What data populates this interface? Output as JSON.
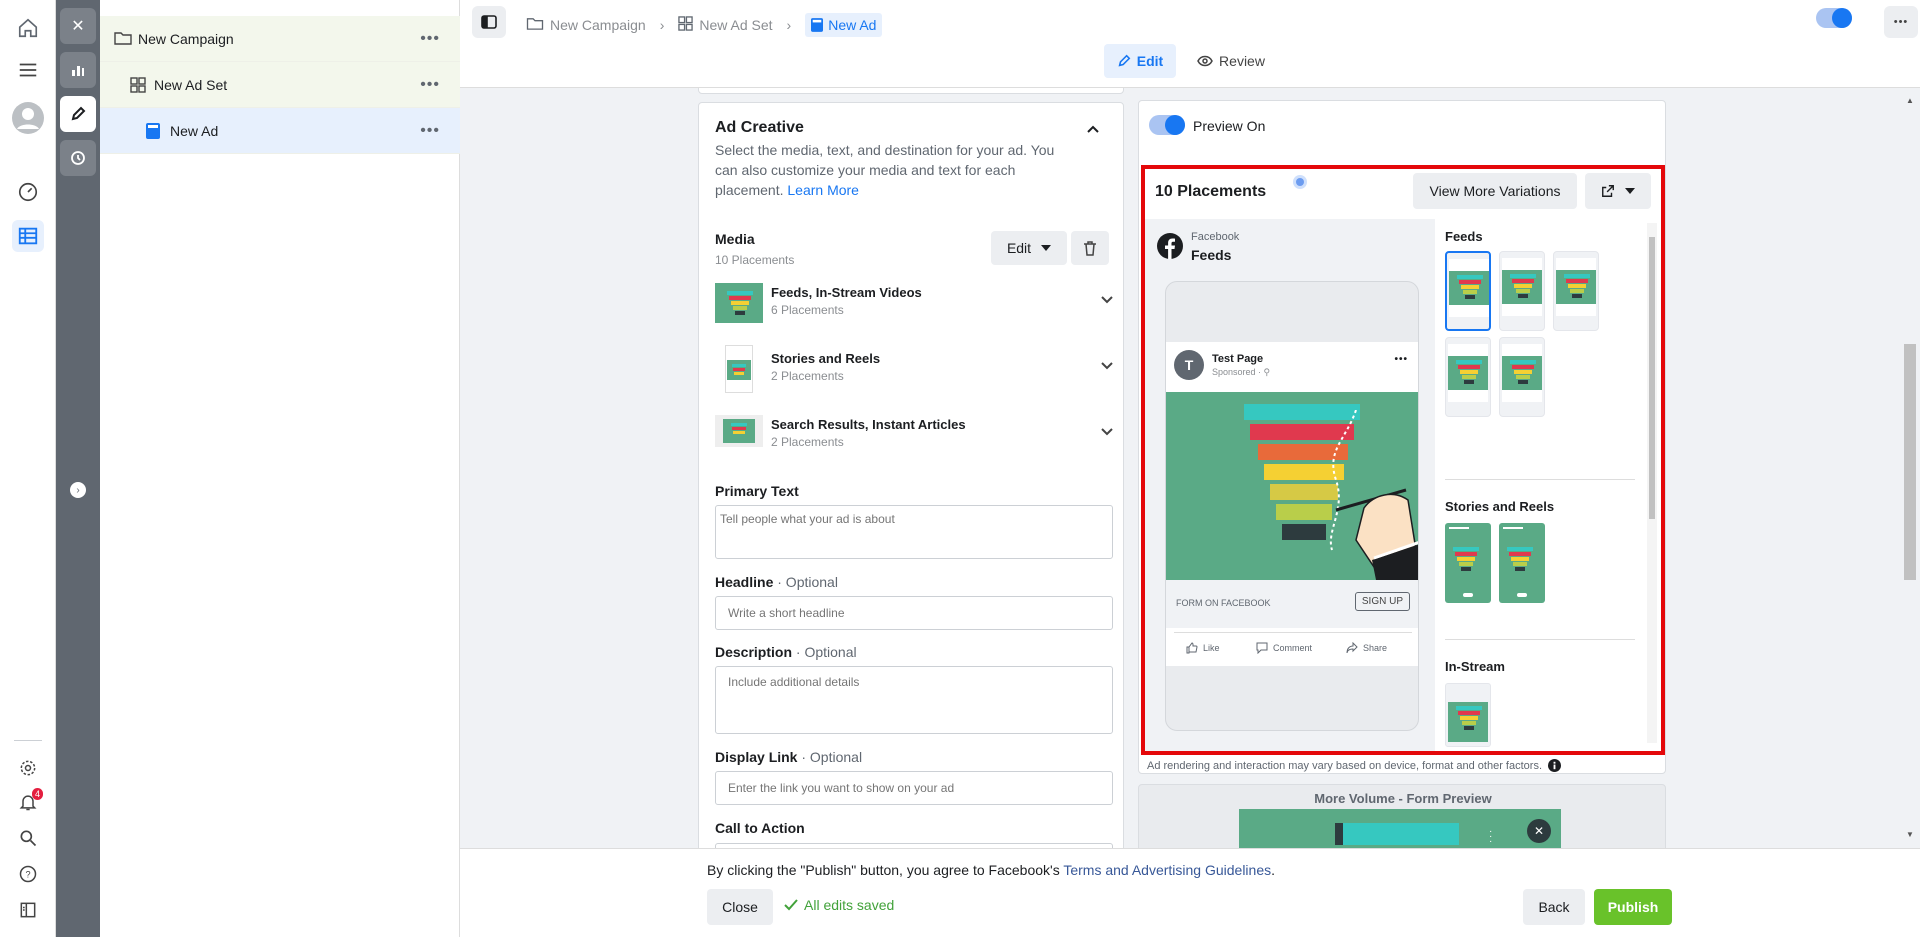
{
  "tree": {
    "campaign": "New Campaign",
    "adset": "New Ad Set",
    "ad": "New Ad",
    "more": "•••"
  },
  "breadcrumb": {
    "campaign": "New Campaign",
    "adset": "New Ad Set",
    "ad": "New Ad"
  },
  "tabs": {
    "edit": "Edit",
    "review": "Review"
  },
  "top_more": "•••",
  "ad_creative": {
    "title": "Ad Creative",
    "desc": "Select the media, text, and destination for your ad. You can also customize your media and text for each placement.",
    "learn_more": "Learn More"
  },
  "media": {
    "title": "Media",
    "count": "10 Placements",
    "edit_label": "Edit",
    "groups": [
      {
        "title": "Feeds, In-Stream Videos",
        "count": "6 Placements"
      },
      {
        "title": "Stories and Reels",
        "count": "2 Placements"
      },
      {
        "title": "Search Results, Instant Articles",
        "count": "2 Placements"
      }
    ]
  },
  "fields": {
    "primary_text": {
      "label": "Primary Text",
      "placeholder": "Tell people what your ad is about"
    },
    "headline": {
      "label": "Headline",
      "optional": "· Optional",
      "placeholder": "Write a short headline"
    },
    "description": {
      "label": "Description",
      "optional": "· Optional",
      "placeholder": "Include additional details"
    },
    "display_link": {
      "label": "Display Link",
      "optional": "· Optional",
      "placeholder": "Enter the link you want to show on your ad"
    },
    "cta": {
      "label": "Call to Action"
    }
  },
  "preview": {
    "toggle_label": "Preview On",
    "placements_title": "10 Placements",
    "view_more": "View More Variations",
    "platform": "Facebook",
    "placement": "Feeds",
    "page_name": "Test Page",
    "page_initial": "T",
    "sponsored": "Sponsored · ⚲",
    "post_more": "•••",
    "cta_caption": "FORM ON FACEBOOK",
    "cta_button": "SIGN UP",
    "like": "Like",
    "comment": "Comment",
    "share": "Share",
    "sections": {
      "feeds": "Feeds",
      "stories": "Stories and Reels",
      "instream": "In-Stream"
    },
    "disclaimer": "Ad rendering and interaction may vary based on device, format and other factors.",
    "more_volume": "More Volume - Form Preview"
  },
  "footer": {
    "agree_text": "By clicking the \"Publish\" button, you agree to Facebook's",
    "terms_link": "Terms and Advertising Guidelines",
    "period": ".",
    "close": "Close",
    "saved": "All edits saved",
    "back": "Back",
    "publish": "Publish"
  },
  "notifications_count": "4",
  "colors": {
    "accent": "#1877f2",
    "publish": "#69c22a",
    "highlight": "#e4080a",
    "funnel_bg": "#5aaa86"
  },
  "icons": [
    "home-icon",
    "menu-icon",
    "avatar-icon",
    "dashboard-icon",
    "table-icon",
    "settings-icon",
    "bell-icon",
    "search-icon",
    "help-icon",
    "sidebar-icon",
    "close-icon",
    "chart-icon",
    "pencil-icon",
    "clock-icon",
    "folder-icon",
    "grid-icon",
    "ad-icon",
    "chevron-right-icon",
    "panel-toggle-icon",
    "eye-icon",
    "trash-icon",
    "caret-down-icon",
    "external-link-icon",
    "facebook-icon",
    "like-icon",
    "comment-icon",
    "share-icon",
    "info-icon",
    "check-icon"
  ]
}
